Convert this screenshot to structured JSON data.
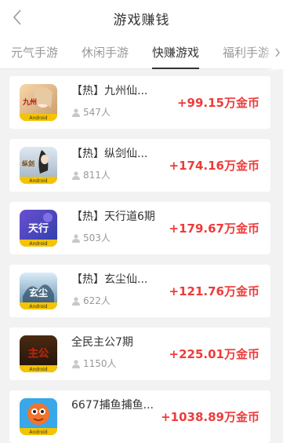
{
  "header": {
    "title": "游戏赚钱",
    "back_icon": "chevron-left-icon"
  },
  "tabs": [
    {
      "label": "元气手游",
      "active": false
    },
    {
      "label": "休闲手游",
      "active": false
    },
    {
      "label": "快赚游戏",
      "active": true
    },
    {
      "label": "福利手游",
      "active": false
    }
  ],
  "tabs_more_icon": "chevron-right-icon",
  "games": [
    {
      "name": "【热】九州仙...",
      "players": "547人",
      "reward": "+99.15万金币",
      "icon_badge": "Android"
    },
    {
      "name": "【热】纵剑仙...",
      "players": "811人",
      "reward": "+174.16万金币",
      "icon_badge": "Android"
    },
    {
      "name": "【热】天行道6期",
      "players": "503人",
      "reward": "+179.67万金币",
      "icon_badge": "Android"
    },
    {
      "name": "【热】玄尘仙...",
      "players": "622人",
      "reward": "+121.76万金币",
      "icon_badge": "Android"
    },
    {
      "name": "全民主公7期",
      "players": "1150人",
      "reward": "+225.01万金币",
      "icon_badge": "Android"
    },
    {
      "name": "6677捕鱼捕鱼...",
      "players": "",
      "reward": "+1038.89万金币",
      "icon_badge": "Android"
    }
  ],
  "colors": {
    "reward": "#ef3a3a",
    "badge": "#f5c400",
    "background": "#f2f2f2"
  }
}
